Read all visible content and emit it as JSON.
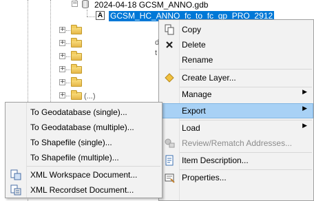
{
  "tree": {
    "gdb_label": "2024-04-18 GCSM_ANNO.gdb",
    "selected_label": "GCSM_HC_ANNO_fc_to_fc_gp_PRO_2912",
    "anno_badge": "A",
    "cut_fragments": [
      "d",
      "t",
      "(...)"
    ]
  },
  "context_menu": {
    "items": [
      {
        "label": "Copy",
        "icon": "copy-icon"
      },
      {
        "label": "Delete",
        "icon": "delete-x-icon"
      },
      {
        "label": "Rename",
        "icon": ""
      },
      {
        "label": "Create Layer...",
        "icon": "layer-diamond-icon"
      },
      {
        "label": "Manage",
        "icon": "",
        "submenu": true
      },
      {
        "label": "Export",
        "icon": "",
        "submenu": true,
        "highlighted": true
      },
      {
        "label": "Load",
        "icon": "",
        "submenu": true
      },
      {
        "label": "Review/Rematch Addresses...",
        "icon": "review-rematch-icon",
        "disabled": true
      },
      {
        "label": "Item Description...",
        "icon": "item-description-icon"
      },
      {
        "label": "Properties...",
        "icon": "properties-icon"
      }
    ]
  },
  "export_submenu": {
    "items": [
      {
        "label": "To Geodatabase (single)..."
      },
      {
        "label": "To Geodatabase (multiple)..."
      },
      {
        "label": "To Shapefile (single)..."
      },
      {
        "label": "To Shapefile (multiple)..."
      },
      {
        "label": "XML Workspace Document...",
        "icon": "xml-workspace-icon"
      },
      {
        "label": "XML Recordset Document...",
        "icon": "xml-recordset-icon"
      }
    ]
  },
  "colors": {
    "selection": "#0078d7",
    "menu_highlight": "#a8d1f5",
    "menu_background": "#f2f2f2"
  }
}
